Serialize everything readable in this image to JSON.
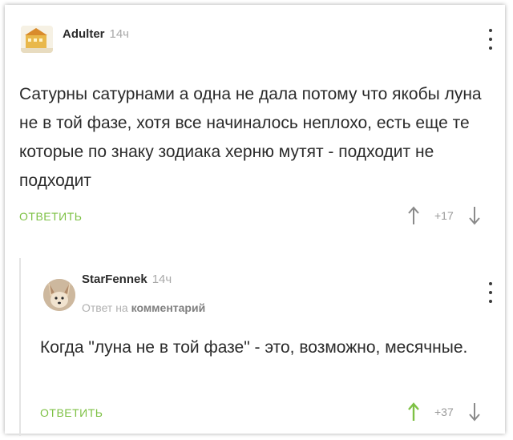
{
  "comments": [
    {
      "author": "Adulter",
      "time": "14ч",
      "text": "Сатурны сатурнами а одна не дала потому что якобы луна не в той фазе, хотя все начиналось неплохо, есть еще те которые по знаку зодиака херню мутят - подходит не подходит",
      "reply_label": "ОТВЕТИТЬ",
      "score": "+17"
    },
    {
      "author": "StarFennek",
      "time": "14ч",
      "reply_prefix": "Ответ на",
      "reply_target": "комментарий",
      "text": "Когда \"луна не в той фазе\" - это, возможно, месячные.",
      "reply_label": "ОТВЕТИТЬ",
      "score": "+37"
    }
  ],
  "colors": {
    "accent": "#7ec145",
    "upvote_active": "#7ec145",
    "muted": "#a8a8a8"
  },
  "icons": [
    "avatar-image",
    "menu-dots-icon",
    "arrow-up-icon",
    "arrow-down-icon"
  ]
}
